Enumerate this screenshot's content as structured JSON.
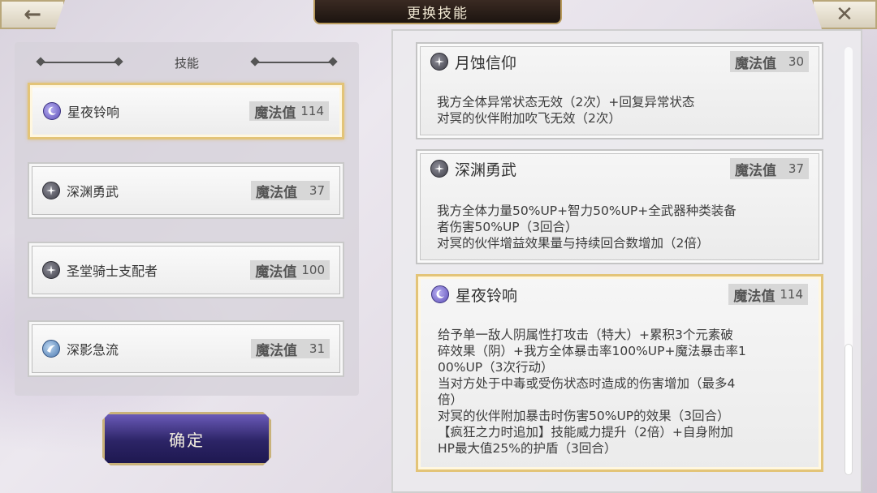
{
  "title": "更换技能",
  "nav": {
    "back_icon": "←",
    "close_icon": "✕"
  },
  "left": {
    "header": "技能",
    "slots": [
      {
        "name": "星夜铃响",
        "icon": "moon-icon",
        "mp_label": "魔法值",
        "mp": "114",
        "selected": true
      },
      {
        "name": "深渊勇武",
        "icon": "star-icon",
        "mp_label": "魔法值",
        "mp": "37",
        "selected": false
      },
      {
        "name": "圣堂骑士支配者",
        "icon": "star-icon",
        "mp_label": "魔法值",
        "mp": "100",
        "selected": false
      },
      {
        "name": "深影急流",
        "icon": "wave-icon",
        "mp_label": "魔法值",
        "mp": "31",
        "selected": false
      }
    ],
    "confirm_label": "确定"
  },
  "details": [
    {
      "name": "月蚀信仰",
      "icon": "star-icon",
      "mp_label": "魔法值",
      "mp": "30",
      "lines": [
        "我方全体异常状态无效（2次）+回复异常状态",
        "对冥的伙伴附加吹飞无效（2次）"
      ]
    },
    {
      "name": "深渊勇武",
      "icon": "star-icon",
      "mp_label": "魔法值",
      "mp": "37",
      "lines": [
        "我方全体力量50%UP+智力50%UP+全武器种类装备",
        "者伤害50%UP（3回合）",
        "对冥的伙伴增益效果量与持续回合数增加（2倍）"
      ]
    },
    {
      "name": "星夜铃响",
      "icon": "moon-icon",
      "mp_label": "魔法值",
      "mp": "114",
      "lines": [
        "给予单一敌人阴属性打攻击（特大）+累积3个元素破",
        "碎效果（阴）+我方全体暴击率100%UP+魔法暴击率1",
        "00%UP（3次行动）",
        "当对方处于中毒或受伤状态时造成的伤害增加（最多4",
        "倍）",
        "对冥的伙伴附加暴击时伤害50%UP的效果（3回合）",
        "【疯狂之力时追加】技能威力提升（2倍）+自身附加",
        "HP最大值25%的护盾（3回合）"
      ]
    }
  ],
  "colors": {
    "selected_border": "#e3c478",
    "title_plate": "#2a1e18",
    "confirm_button": "#2c2466"
  }
}
